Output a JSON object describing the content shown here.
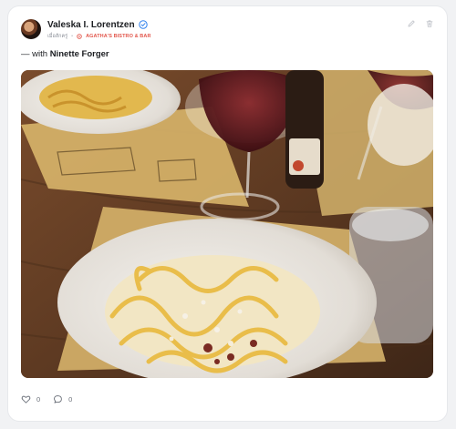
{
  "post": {
    "author": {
      "name": "Valeska I. Lorentzen",
      "verified": true,
      "avatar": "avatar-photo"
    },
    "time": "เมื่อสักครู่",
    "location": "AGATHA'S BISTRO & BAR",
    "with_prefix": "— with",
    "with_name": "Ninette Forger",
    "photo": "pasta-dinner-photo"
  },
  "reactions": {
    "likes": "0",
    "comments": "0"
  },
  "icons": {
    "verified": "verified-badge-icon",
    "location": "location-pin-icon",
    "edit": "pencil-icon",
    "delete": "trash-icon",
    "like": "heart-icon",
    "comment": "comment-bubble-icon"
  },
  "colors": {
    "location": "#e2574c",
    "verified": "#2f80ed",
    "text": "#1b1d21",
    "muted": "#8a8f98"
  }
}
